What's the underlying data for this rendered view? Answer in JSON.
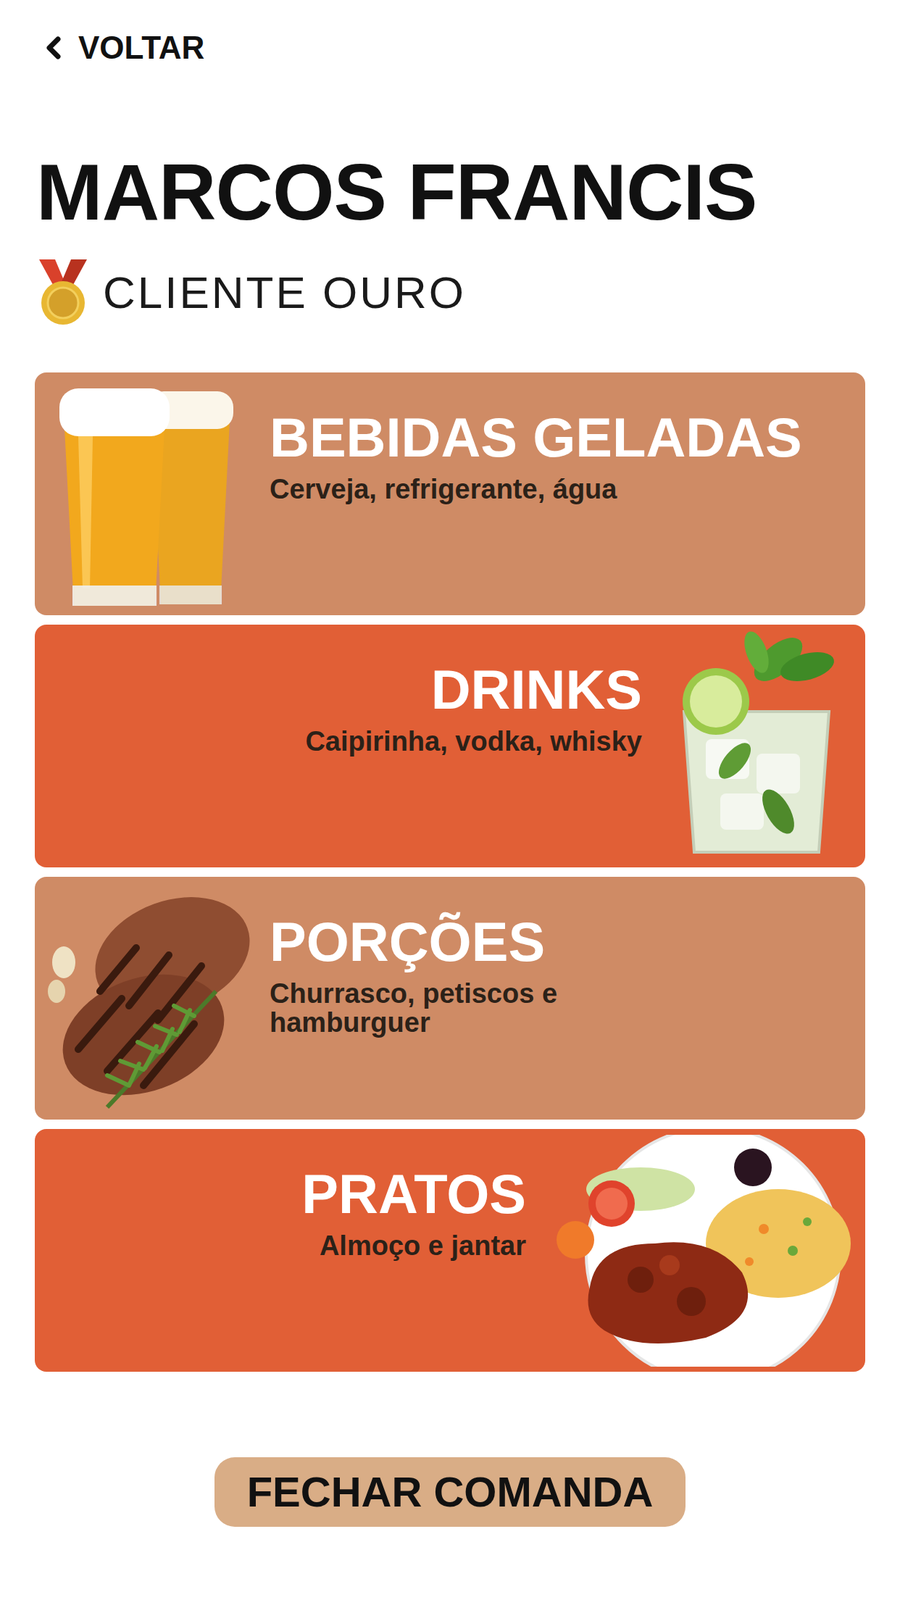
{
  "header": {
    "back_label": "VOLTAR"
  },
  "customer": {
    "name": "MARCOS FRANCIS",
    "tier": "CLIENTE OURO"
  },
  "categories": [
    {
      "title": "BEBIDAS GELADAS",
      "subtitle": "Cerveja, refrigerante, água",
      "kind": "left"
    },
    {
      "title": "DRINKS",
      "subtitle": "Caipirinha, vodka, whisky",
      "kind": "right"
    },
    {
      "title": "PORÇÕES",
      "subtitle": "Churrasco, petiscos e hamburguer",
      "kind": "left"
    },
    {
      "title": "PRATOS",
      "subtitle": "Almoço e jantar",
      "kind": "right"
    }
  ],
  "footer": {
    "button": "FECHAR COMANDA"
  }
}
